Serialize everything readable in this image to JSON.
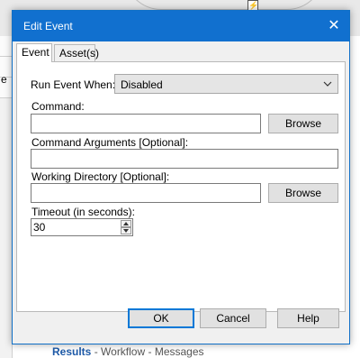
{
  "background": {
    "left_panel_label": "e",
    "bottom_tabs": {
      "active": "Results",
      "items": [
        "Workflow",
        "Messages"
      ],
      "separator": " - "
    },
    "bolt_icon": "lightning-icon"
  },
  "dialog": {
    "title": "Edit Event",
    "close_glyph": "✕",
    "tabs": [
      "Event",
      "Asset(s)"
    ],
    "active_tab": "Event",
    "run_event_when": {
      "label": "Run Event When:",
      "selected": "Disabled"
    },
    "command": {
      "label": "Command:",
      "value": "",
      "browse_label": "Browse"
    },
    "command_arguments": {
      "label": "Command Arguments [Optional]:",
      "value": ""
    },
    "working_directory": {
      "label": "Working Directory [Optional]:",
      "value": "",
      "browse_label": "Browse"
    },
    "timeout": {
      "label": "Timeout (in seconds):",
      "value": "30"
    },
    "buttons": {
      "ok": "OK",
      "cancel": "Cancel",
      "help": "Help"
    },
    "colors": {
      "titlebar": "#1170cf",
      "default_button_border": "#0078d7"
    }
  }
}
